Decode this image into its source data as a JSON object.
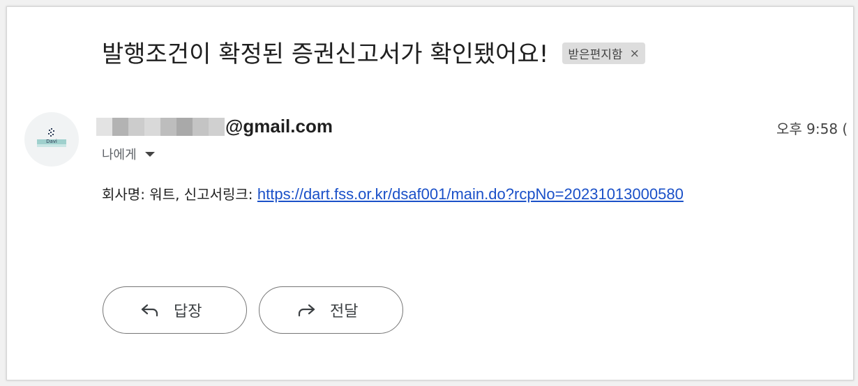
{
  "email": {
    "subject": "발행조건이 확정된 증권신고서가 확인됐어요!",
    "label": "받은편지함",
    "label_remove_icon": "close-icon",
    "sender_domain": "@gmail.com",
    "recipient": "나에게",
    "time": "오후 9:58 (",
    "avatar_text": "Davi",
    "body_prefix": "회사명: 워트, 신고서링크: ",
    "body_link": "https://dart.fss.or.kr/dsaf001/main.do?rcpNo=20231013000580"
  },
  "actions": {
    "reply_label": "답장",
    "reply_icon": "reply-icon",
    "forward_label": "전달",
    "forward_icon": "forward-icon"
  },
  "colors": {
    "link": "#1a50c8",
    "label_chip_bg": "#dddddd",
    "button_border": "#757575"
  }
}
